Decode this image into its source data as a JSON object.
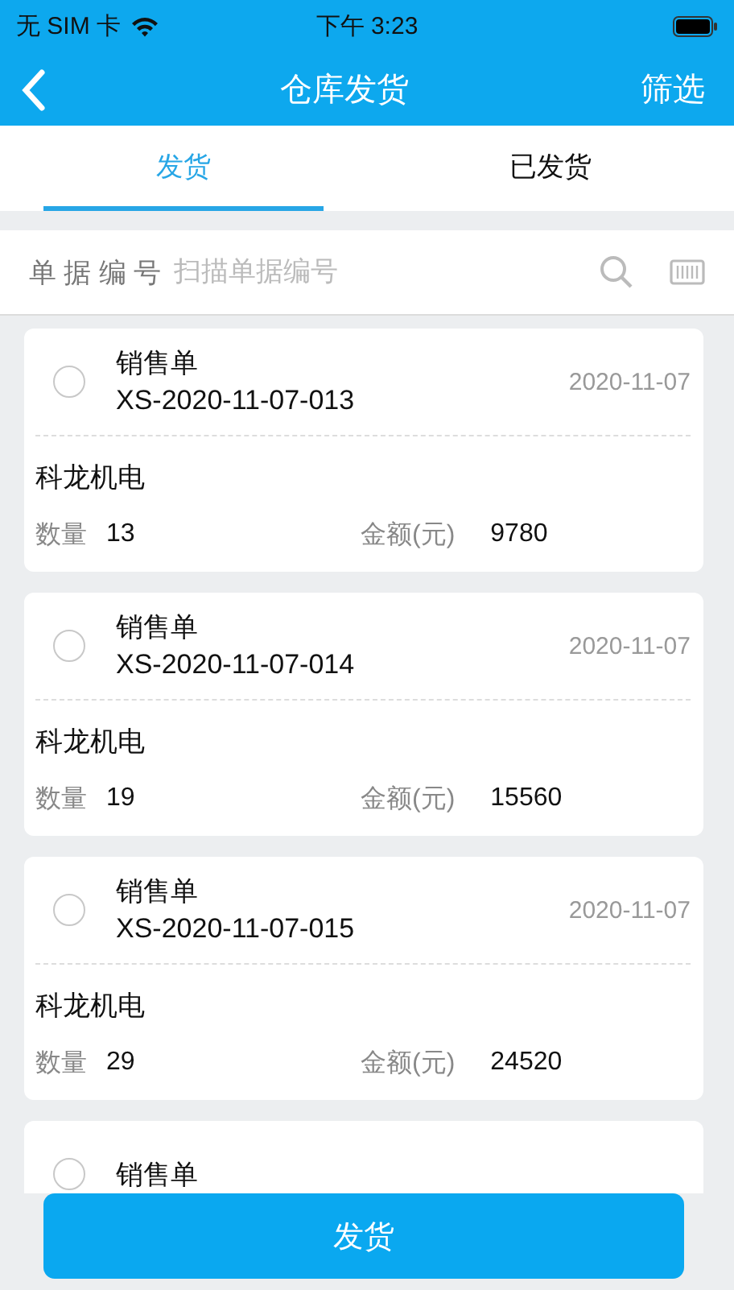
{
  "status_bar": {
    "carrier": "无 SIM 卡",
    "time": "下午 3:23"
  },
  "nav": {
    "title": "仓库发货",
    "action": "筛选"
  },
  "tabs": [
    {
      "label": "发货",
      "selected": true
    },
    {
      "label": "已发货",
      "selected": false
    }
  ],
  "search": {
    "label": "单 据 编 号",
    "placeholder": "扫描单据编号"
  },
  "orders": [
    {
      "checked": false,
      "type": "销售单",
      "number": "XS-2020-11-07-013",
      "date": "2020-11-07",
      "customer": "科龙机电",
      "qty_label": "数量",
      "qty": "13",
      "amount_label": "金额(元)",
      "amount": "9780"
    },
    {
      "checked": false,
      "type": "销售单",
      "number": "XS-2020-11-07-014",
      "date": "2020-11-07",
      "customer": "科龙机电",
      "qty_label": "数量",
      "qty": "19",
      "amount_label": "金额(元)",
      "amount": "15560"
    },
    {
      "checked": false,
      "type": "销售单",
      "number": "XS-2020-11-07-015",
      "date": "2020-11-07",
      "customer": "科龙机电",
      "qty_label": "数量",
      "qty": "29",
      "amount_label": "金额(元)",
      "amount": "24520"
    },
    {
      "checked": false,
      "type": "销售单"
    }
  ],
  "footer": {
    "button": "发货"
  }
}
